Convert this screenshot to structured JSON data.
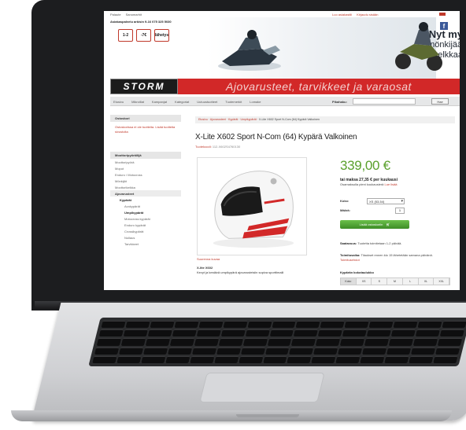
{
  "topbar": {
    "links": [
      "Palaute",
      "Sanomarhit"
    ],
    "account": [
      "Luo asiakastili",
      "Kirjaudu sisään"
    ]
  },
  "phone": "Asiakaspalvelu arkisin 9-16 075 325 5030",
  "badges": [
    "1-2",
    "-7€",
    "lähetys"
  ],
  "promo": {
    "line1": "Nyt myös",
    "line2": "mönkijään ja",
    "line3": "kelkkaan!"
  },
  "brand": {
    "logo": "STORM",
    "tagline": "Ajovarusteet, tarvikkeet ja varaosat"
  },
  "nav": {
    "items": [
      "Etusivu",
      "Mikroillat",
      "Kampanjat",
      "Kategoriat",
      "Uutuustuotteet",
      "Tuotemerkit",
      "Lomake"
    ],
    "search_label": "Pikahaku:",
    "search_button": "Hae"
  },
  "sidebar": {
    "cart_title": "Ostoskori",
    "cart_text": "Ostoskorissa ei ole tuotteita. Lisää tuotteita sivustolta",
    "categories_title": "Moottoripyöräilijä",
    "categories": [
      "Moottoripyörä",
      "Mopot",
      "Enduro / Motocross",
      "Mönkijät",
      "Moottorikelkka",
      "Ajovarusteet",
      "Kypärät"
    ],
    "subcategories": [
      "Avokypärät",
      "Umpikypärät",
      "Motocross kypärät",
      "Enduro kypärät",
      "Crossikypärät",
      "Nollaus",
      "Tarvikkeet"
    ]
  },
  "breadcrumb": {
    "trail": "Etusivu · Ajovarusteet · Kypärät · Umpikypärät · ",
    "current": "X-Lite X602 Sport N-Com (64) Kypärä Valkoinen"
  },
  "product": {
    "title": "X-Lite X602 Sport N-Com (64) Kypärä Valkoinen",
    "meta_label": "Tuotekoodi:",
    "meta_value": "112-X602S4760130",
    "photo_caption": "Suurenna kuvaa",
    "desc_title": "X-lite X602",
    "desc_text": "Kevyt ja kestävä umpikypärä ajovarusteisiin sopiva sporttimalli",
    "price": "339,00 €",
    "installment": "tai maksa 27,35 € per kuukausi",
    "installment_note": "Osamaksulla pieni kuukausierä",
    "installment_link": "Lue lisää",
    "size_label": "Koko:",
    "size_value": "XS (53-54)",
    "qty_label": "Määrä:",
    "qty_value": "1",
    "cart_button": "Lisää ostoskoriin",
    "availability_label": "Saatavuus:",
    "availability_text": "Tuotetta toimitetaan 1-2 päivää.",
    "shipping_label": "Toimitusaika:",
    "shipping_text": "Tilaukset ennen klo 15 lähetetään samana päivänä.",
    "shipping_link": "Toimitusehdot",
    "table_title": "Kypärän kokotaulukko",
    "table_cols": [
      "Koko",
      "XS",
      "S",
      "M",
      "L",
      "XL",
      "XXL"
    ]
  }
}
